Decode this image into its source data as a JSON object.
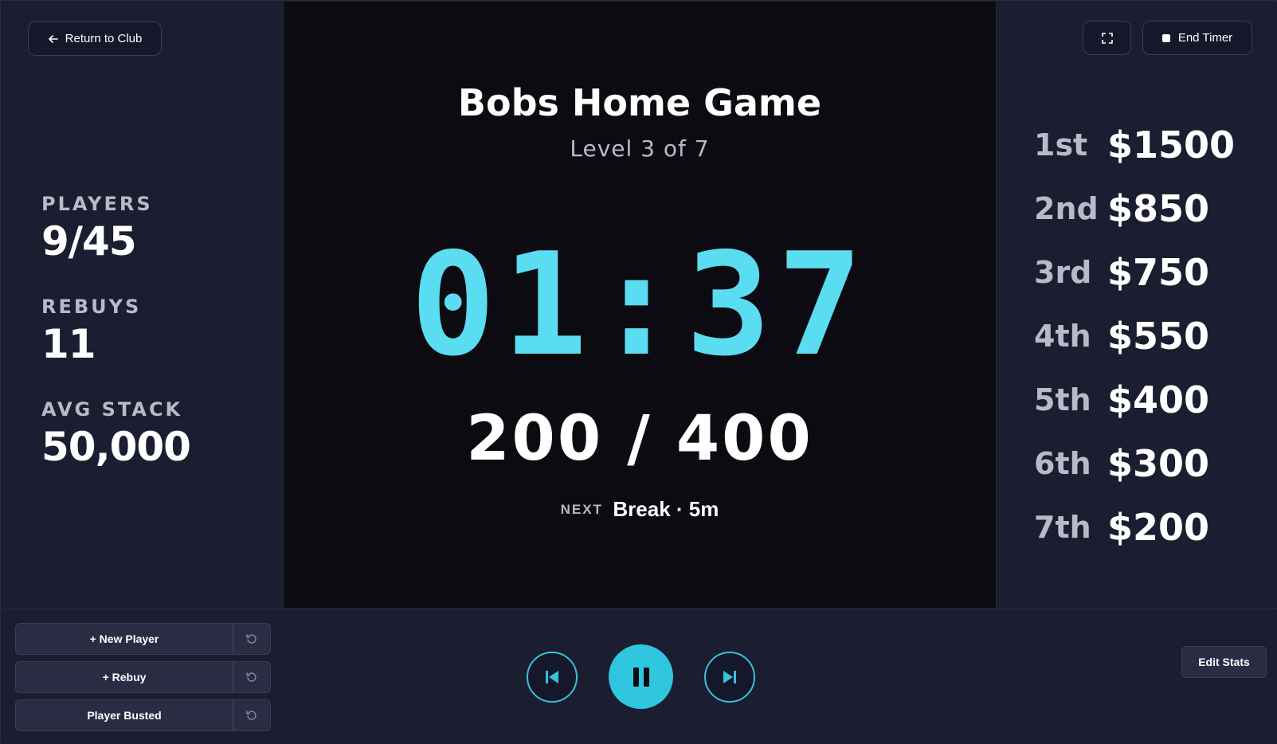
{
  "header": {
    "return_label": "Return to Club",
    "end_label": "End Timer"
  },
  "stats": {
    "players_label": "PLAYERS",
    "players_value": "9/45",
    "rebuys_label": "REBUYS",
    "rebuys_value": "11",
    "avg_stack_label": "AVG STACK",
    "avg_stack_value": "50,000"
  },
  "game": {
    "title": "Bobs Home Game",
    "level": "Level 3 of 7",
    "timer": "01:37",
    "blinds": "200 / 400",
    "next_label": "NEXT",
    "next_value": "Break · 5m"
  },
  "payouts": [
    {
      "place": "1st",
      "amount": "$1500"
    },
    {
      "place": "2nd",
      "amount": "$850"
    },
    {
      "place": "3rd",
      "amount": "$750"
    },
    {
      "place": "4th",
      "amount": "$550"
    },
    {
      "place": "5th",
      "amount": "$400"
    },
    {
      "place": "6th",
      "amount": "$300"
    },
    {
      "place": "7th",
      "amount": "$200"
    }
  ],
  "actions": {
    "new_player": "+ New Player",
    "rebuy": "+ Rebuy",
    "busted": "Player Busted",
    "edit_stats": "Edit Stats"
  },
  "colors": {
    "accent": "#5adcf1",
    "background": "#1b1d30",
    "center_background": "#0b0b11"
  }
}
